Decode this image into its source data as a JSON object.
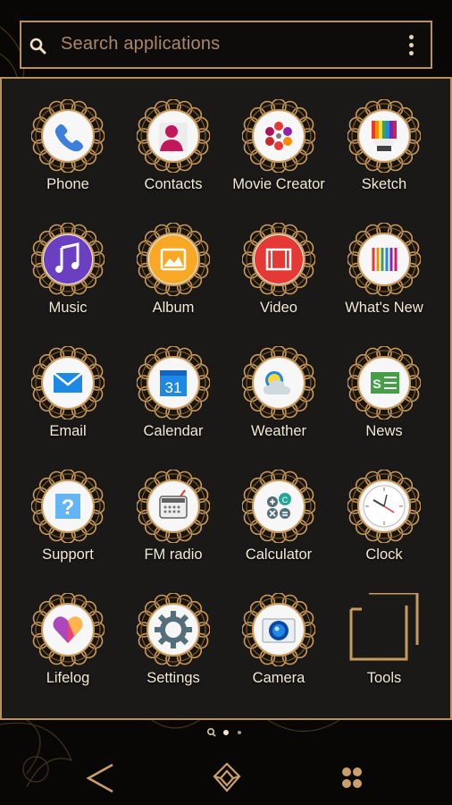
{
  "search": {
    "placeholder": "Search applications"
  },
  "apps": [
    {
      "label": "Phone",
      "icon": "phone-icon"
    },
    {
      "label": "Contacts",
      "icon": "contacts-icon"
    },
    {
      "label": "Movie Creator",
      "icon": "movie-creator-icon"
    },
    {
      "label": "Sketch",
      "icon": "sketch-icon"
    },
    {
      "label": "Music",
      "icon": "music-icon"
    },
    {
      "label": "Album",
      "icon": "album-icon"
    },
    {
      "label": "Video",
      "icon": "video-icon"
    },
    {
      "label": "What's New",
      "icon": "whats-new-icon"
    },
    {
      "label": "Email",
      "icon": "email-icon"
    },
    {
      "label": "Calendar",
      "icon": "calendar-icon",
      "date": "31"
    },
    {
      "label": "Weather",
      "icon": "weather-icon"
    },
    {
      "label": "News",
      "icon": "news-icon"
    },
    {
      "label": "Support",
      "icon": "support-icon"
    },
    {
      "label": "FM radio",
      "icon": "radio-icon"
    },
    {
      "label": "Calculator",
      "icon": "calculator-icon"
    },
    {
      "label": "Clock",
      "icon": "clock-icon"
    },
    {
      "label": "Lifelog",
      "icon": "lifelog-icon"
    },
    {
      "label": "Settings",
      "icon": "gear-icon"
    },
    {
      "label": "Camera",
      "icon": "camera-icon"
    },
    {
      "label": "Tools",
      "icon": "tools-folder-icon"
    }
  ],
  "pager": {
    "pages": 2,
    "current": 1
  },
  "navbar": {
    "items": [
      "back-icon",
      "home-icon",
      "recents-icon"
    ]
  },
  "colors": {
    "accent": "#b8905a",
    "panel": "#1b1917",
    "label": "#f3ead8"
  }
}
